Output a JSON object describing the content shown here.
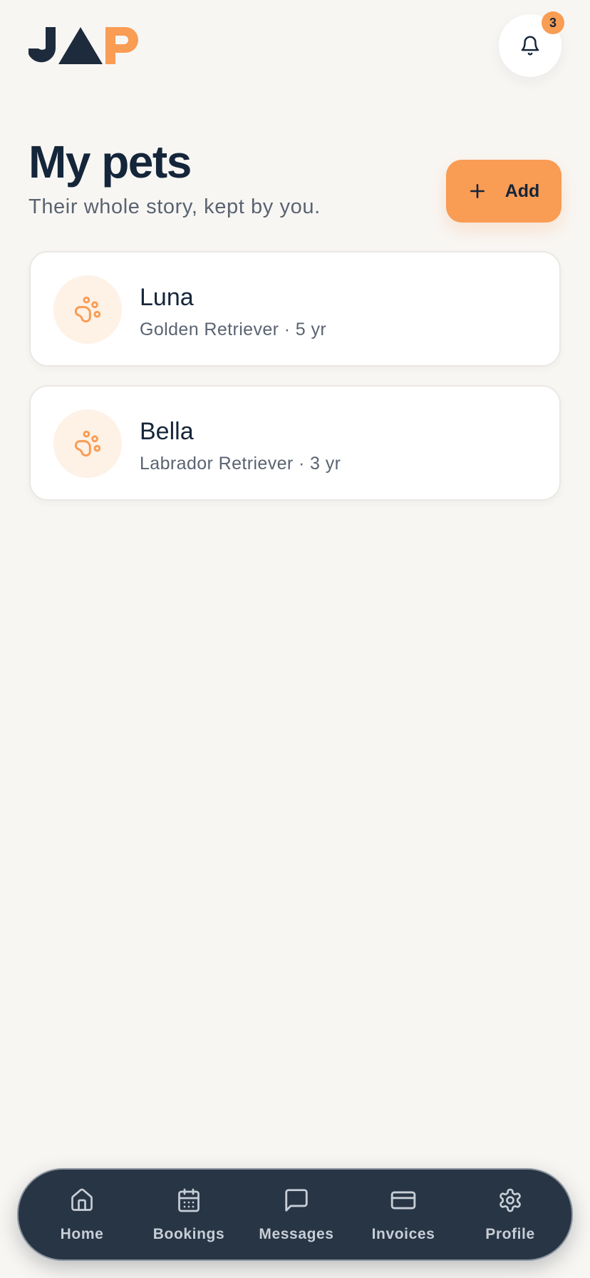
{
  "header": {
    "logo_text": "JAP",
    "notification_count": "3"
  },
  "main": {
    "title": "My pets",
    "subtitle": "Their whole story, kept by you.",
    "add_label": "Add"
  },
  "pets": [
    {
      "name": "Luna",
      "details": "Golden Retriever · 5 yr"
    },
    {
      "name": "Bella",
      "details": "Labrador Retriever · 3 yr"
    }
  ],
  "nav": {
    "items": [
      {
        "label": "Home",
        "icon": "home-icon"
      },
      {
        "label": "Bookings",
        "icon": "calendar-icon"
      },
      {
        "label": "Messages",
        "icon": "message-icon"
      },
      {
        "label": "Invoices",
        "icon": "card-icon"
      },
      {
        "label": "Profile",
        "icon": "gear-icon"
      }
    ]
  },
  "colors": {
    "accent": "#f99c54",
    "navy": "#1d2b3d",
    "background": "#f8f6f3",
    "nav_background": "#273545"
  }
}
